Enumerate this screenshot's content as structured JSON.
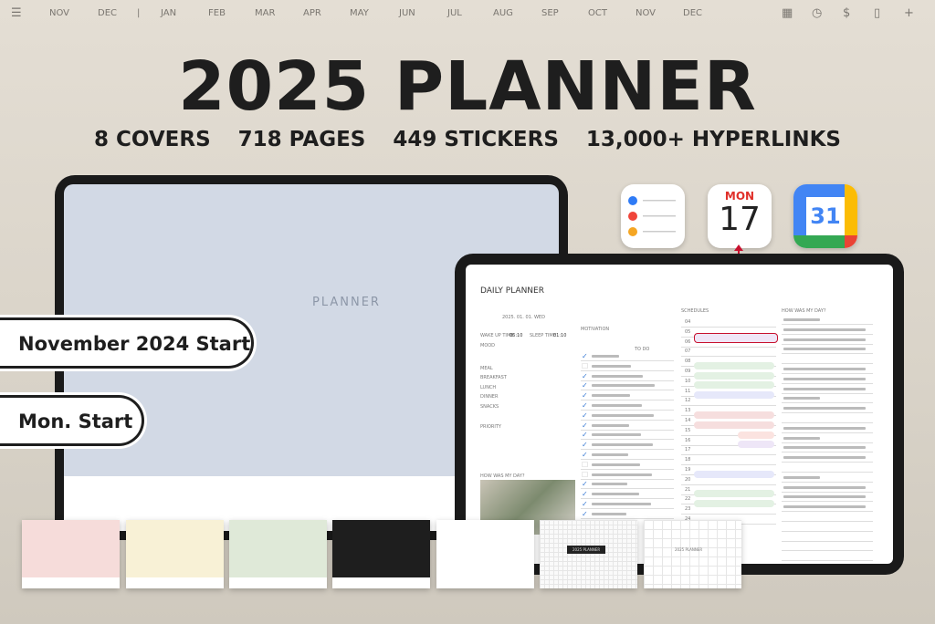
{
  "top_nav": {
    "months": [
      "NOV",
      "DEC",
      "JAN",
      "FEB",
      "MAR",
      "APR",
      "MAY",
      "JUN",
      "JUL",
      "AUG",
      "SEP",
      "OCT",
      "NOV",
      "DEC"
    ],
    "icons": [
      "calendar-icon",
      "clock-icon",
      "dollar-icon",
      "notebook-icon",
      "plus-icon"
    ]
  },
  "headline": {
    "title": "2025 PLANNER",
    "features": [
      "8 COVERS",
      "718 PAGES",
      "449 STICKERS",
      "13,000+ HYPERLINKS"
    ]
  },
  "badges": {
    "start": "November 2024 Start",
    "week": "Mon. Start"
  },
  "cover_tablet": {
    "vertical_word": "PLANNER"
  },
  "apps": {
    "calendar_day": "MON",
    "calendar_date": "17",
    "google_date": "31"
  },
  "daily": {
    "title": "DAILY PLANNER",
    "date": "2025. 01. 01. WED",
    "wake_label": "WAKE UP TIME",
    "wake": "06:10",
    "sleep_label": "SLEEP TIME",
    "sleep": "01:10",
    "mood": "MOOD",
    "meal": "MEAL",
    "meals": [
      "BREAKFAST",
      "LUNCH",
      "DINNER",
      "SNACKS"
    ],
    "priority": "PRIORITY",
    "how": "HOW WAS MY DAY?",
    "motivation": "MOTIVATION",
    "todo": "TO DO",
    "schedules": "SCHEDULES",
    "how2": "HOW WAS MY DAY?",
    "hours": [
      "04",
      "05",
      "06",
      "07",
      "08",
      "09",
      "10",
      "11",
      "12",
      "13",
      "14",
      "15",
      "16",
      "17",
      "18",
      "19",
      "20",
      "21",
      "22",
      "23",
      "24"
    ]
  },
  "covers": {
    "label": "2025 PLANNER",
    "colors": [
      "#f6dcda",
      "#f8f1d6",
      "#dfe9d8",
      "#1e1e1e",
      "#ffffff",
      "#ffffff",
      "#ffffff"
    ]
  },
  "colors": {
    "accent_red": "#c8102e"
  }
}
